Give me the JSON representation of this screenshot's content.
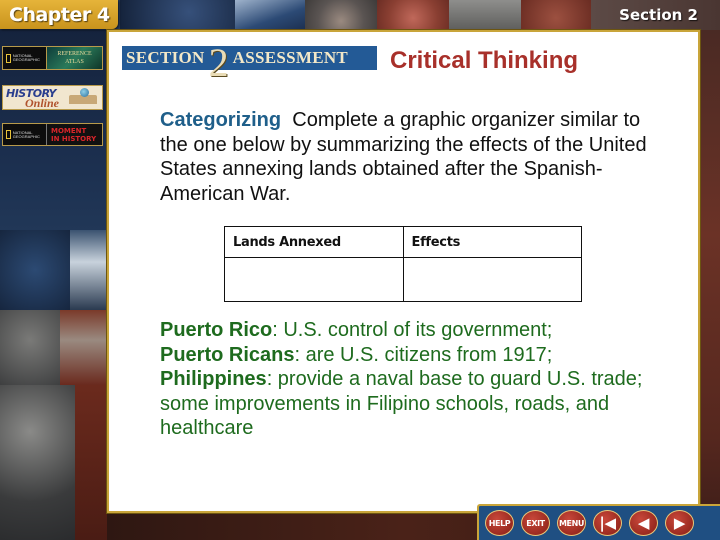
{
  "header": {
    "chapter_label": "Chapter 4",
    "section_label": "Section 2"
  },
  "sidebar": {
    "resources": [
      {
        "id": "reference-atlas",
        "publisher": "NATIONAL GEOGRAPHIC",
        "label_line1": "REFERENCE",
        "label_line2": "ATLAS"
      },
      {
        "id": "history-online",
        "label_line1": "HISTORY",
        "label_line2": "Online"
      },
      {
        "id": "moment-in-history",
        "publisher": "NATIONAL GEOGRAPHIC",
        "label_line1": "MOMENT",
        "label_line2": "IN HISTORY"
      }
    ]
  },
  "panel": {
    "banner": {
      "word1": "SECTION",
      "number": "2",
      "word2": "ASSESSMENT"
    },
    "title": "Critical Thinking",
    "question": {
      "skill": "Categorizing",
      "prompt": "Complete a graphic organizer similar to the one below by summarizing the effects of the United States annexing lands obtained after the Spanish-American War."
    },
    "organizer": {
      "headers": [
        "Lands Annexed",
        "Effects"
      ],
      "rows": [
        [
          "",
          ""
        ]
      ]
    },
    "answer": [
      {
        "term": "Puerto Rico",
        "text": ": U.S. control of its government;"
      },
      {
        "term": "Puerto Ricans",
        "text": ": are U.S. citizens from 1917;"
      },
      {
        "term": "Philippines",
        "text": ": provide a naval base to guard U.S. trade; some improvements in Filipino schools, roads, and healthcare"
      }
    ]
  },
  "navbar": {
    "buttons": [
      {
        "id": "help",
        "label": "HELP"
      },
      {
        "id": "exit",
        "label": "EXIT"
      },
      {
        "id": "menu",
        "label": "MENU"
      },
      {
        "id": "first",
        "label": "|◀",
        "icon": "first-slide-icon"
      },
      {
        "id": "prev",
        "label": "◀",
        "icon": "arrow-left-icon"
      },
      {
        "id": "next",
        "label": "▶",
        "icon": "arrow-right-icon"
      }
    ]
  },
  "colors": {
    "title_red": "#a8302a",
    "skill_blue": "#1f5f8a",
    "answer_green": "#1e6b1e",
    "banner_blue": "#235a96",
    "gold_border": "#c9a53a",
    "nav_blue": "#1f4f82",
    "button_red": "#9a2a20"
  }
}
